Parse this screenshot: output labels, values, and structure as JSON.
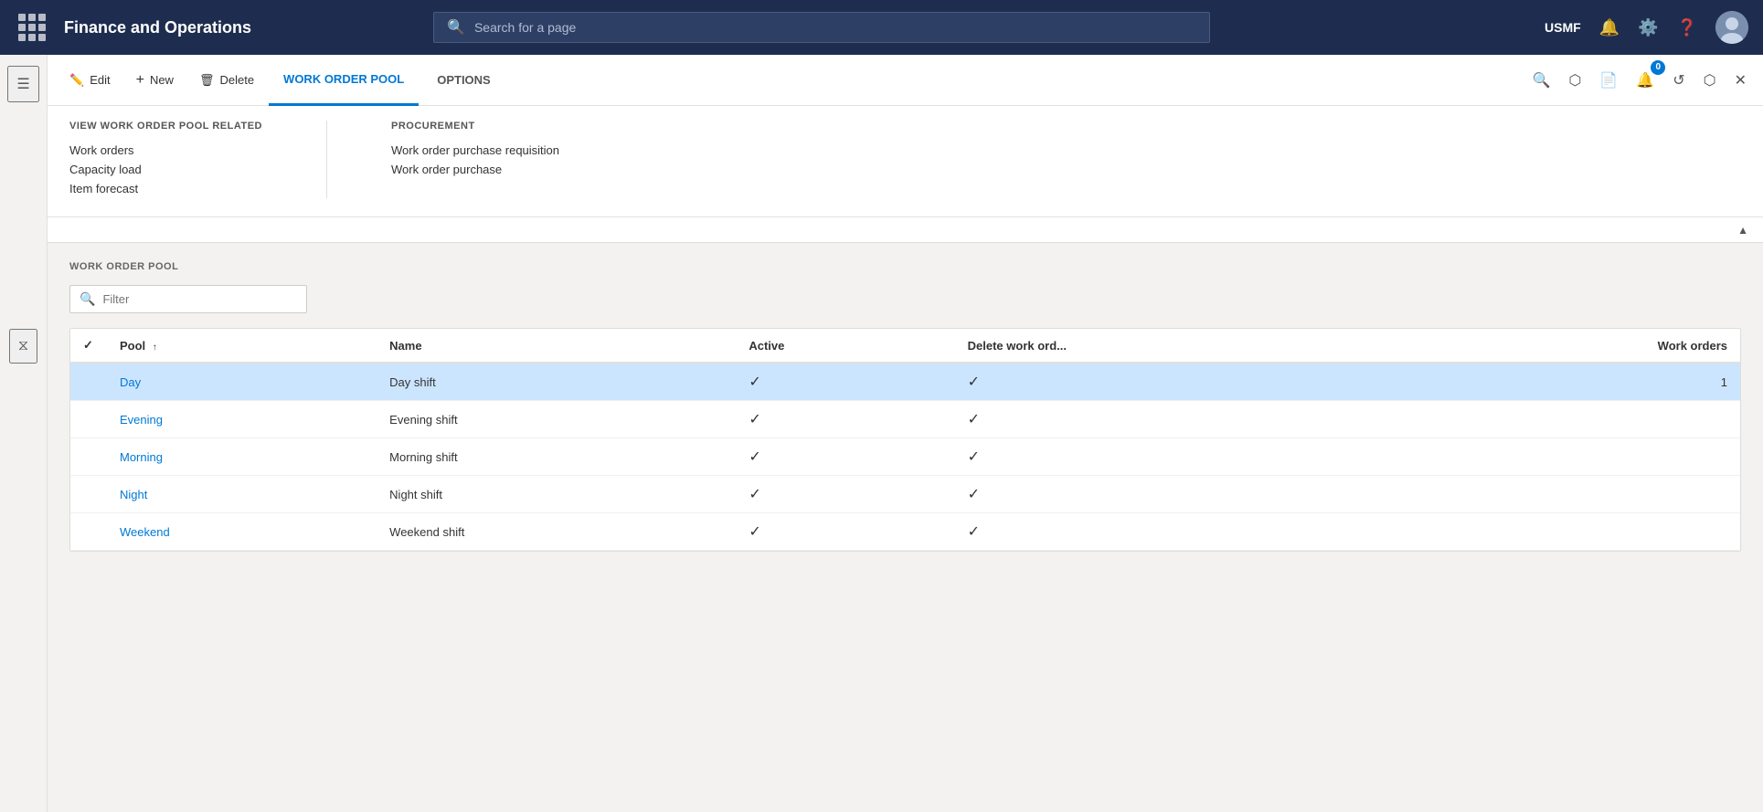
{
  "app": {
    "brand": "Finance and Operations",
    "search_placeholder": "Search for a page",
    "company": "USMF"
  },
  "toolbar": {
    "edit_label": "Edit",
    "new_label": "New",
    "delete_label": "Delete",
    "tab_work_order_pool": "WORK ORDER POOL",
    "tab_options": "OPTIONS",
    "badge_count": "0"
  },
  "dropdown": {
    "view_section_title": "VIEW WORK ORDER POOL RELATED",
    "view_links": [
      "Work orders",
      "Capacity load",
      "Item forecast"
    ],
    "procurement_section_title": "PROCUREMENT",
    "procurement_links": [
      "Work order purchase requisition",
      "Work order purchase"
    ]
  },
  "section": {
    "title": "WORK ORDER POOL",
    "filter_placeholder": "Filter"
  },
  "table": {
    "columns": [
      "",
      "Pool",
      "Name",
      "Active",
      "Delete work ord...",
      "Work orders"
    ],
    "rows": [
      {
        "pool": "Day",
        "name": "Day shift",
        "active": true,
        "delete": true,
        "work_orders": "1",
        "selected": true
      },
      {
        "pool": "Evening",
        "name": "Evening shift",
        "active": true,
        "delete": true,
        "work_orders": "",
        "selected": false
      },
      {
        "pool": "Morning",
        "name": "Morning shift",
        "active": true,
        "delete": true,
        "work_orders": "",
        "selected": false
      },
      {
        "pool": "Night",
        "name": "Night shift",
        "active": true,
        "delete": true,
        "work_orders": "",
        "selected": false
      },
      {
        "pool": "Weekend",
        "name": "Weekend shift",
        "active": true,
        "delete": true,
        "work_orders": "",
        "selected": false
      }
    ]
  }
}
